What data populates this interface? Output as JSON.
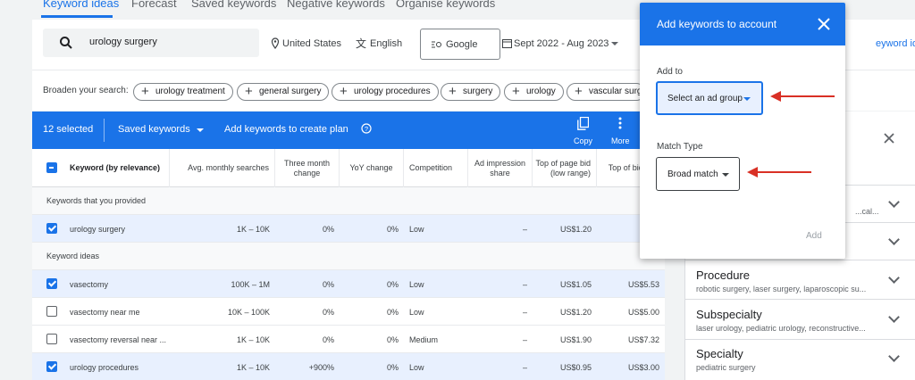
{
  "tabs": [
    {
      "label": "Keyword ideas",
      "active": true
    },
    {
      "label": "Forecast"
    },
    {
      "label": "Saved keywords"
    },
    {
      "label": "Negative keywords"
    },
    {
      "label": "Organise keywords"
    }
  ],
  "search": {
    "query": "urology surgery",
    "location": "United States",
    "language": "English",
    "network": "Google",
    "date_range": "Sept 2022 - Aug 2023",
    "refine_link": "eyword ideas"
  },
  "broaden": {
    "label": "Broaden your search:",
    "chips": [
      "urology treatment",
      "general surgery",
      "urology procedures",
      "surgery",
      "urology",
      "vascular surge"
    ]
  },
  "action_bar": {
    "selected": "12 selected",
    "saved_keywords": "Saved keywords",
    "add_to_plan": "Add keywords to create plan",
    "copy": "Copy",
    "more": "More"
  },
  "table": {
    "headers": [
      "Keyword (by relevance)",
      "Avg. monthly searches",
      "Three month change",
      "YoY change",
      "Competition",
      "Ad impression share",
      "Top of page bid (low range)",
      "Top of bid ra"
    ],
    "group_provided": "Keywords that you provided",
    "group_ideas": "Keyword ideas",
    "provided_rows": [
      {
        "keyword": "urology surgery",
        "searches": "1K – 10K",
        "three_month": "0%",
        "yoy": "0%",
        "competition": "Low",
        "impression": "–",
        "bid_low": "US$1.20",
        "bid_high": "US$",
        "checked": true
      }
    ],
    "idea_rows": [
      {
        "keyword": "vasectomy",
        "searches": "100K – 1M",
        "three_month": "0%",
        "yoy": "0%",
        "competition": "Low",
        "impression": "–",
        "bid_low": "US$1.05",
        "bid_high": "US$5.53",
        "checked": true
      },
      {
        "keyword": "vasectomy near me",
        "searches": "10K – 100K",
        "three_month": "0%",
        "yoy": "0%",
        "competition": "Low",
        "impression": "–",
        "bid_low": "US$1.20",
        "bid_high": "US$5.00",
        "checked": false
      },
      {
        "keyword": "vasectomy reversal near ...",
        "searches": "1K – 10K",
        "three_month": "0%",
        "yoy": "0%",
        "competition": "Medium",
        "impression": "–",
        "bid_low": "US$1.90",
        "bid_high": "US$7.32",
        "checked": false
      },
      {
        "keyword": "urology procedures",
        "searches": "1K – 10K",
        "three_month": "+900%",
        "yoy": "0%",
        "competition": "Low",
        "impression": "–",
        "bid_low": "US$0.95",
        "bid_high": "US$3.00",
        "checked": true
      }
    ]
  },
  "refine_panel": {
    "items": [
      {
        "title": "",
        "sub": "...cal..."
      },
      {
        "title": "",
        "sub": ""
      },
      {
        "title": "Procedure",
        "sub": "robotic surgery, laser surgery, laparoscopic su..."
      },
      {
        "title": "Subspecialty",
        "sub": "laser urology, pediatric urology, reconstructive..."
      },
      {
        "title": "Specialty",
        "sub": "pediatric surgery"
      }
    ]
  },
  "dialog": {
    "title": "Add keywords to account",
    "add_to_label": "Add to",
    "ad_group_select": "Select an ad group",
    "match_type_label": "Match Type",
    "match_type_select": "Broad match",
    "add_button": "Add"
  },
  "colors": {
    "accent": "#1a73e8",
    "arrow": "#d93025"
  }
}
